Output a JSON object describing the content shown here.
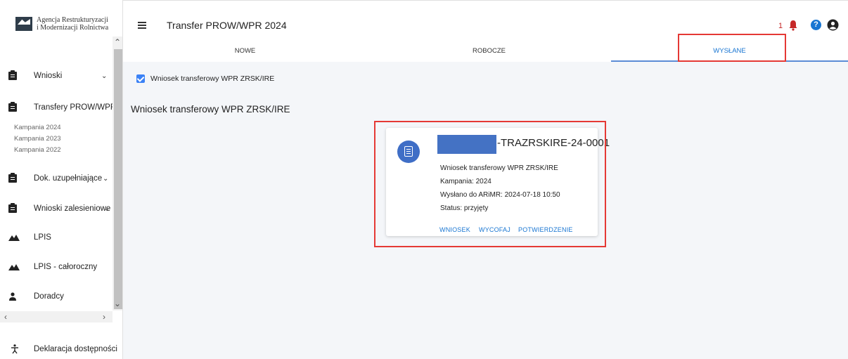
{
  "logo": {
    "line1": "Agencja Restrukturyzacji",
    "line2": "i Modernizacji Rolnictwa"
  },
  "header": {
    "title": "Transfer PROW/WPR 2024",
    "notification_count": "1"
  },
  "tabs": [
    {
      "label": "NOWE",
      "active": false
    },
    {
      "label": "ROBOCZE",
      "active": false
    },
    {
      "label": "WYSŁANE",
      "active": true
    }
  ],
  "sidebar": {
    "items": [
      {
        "label": "Wnioski",
        "icon": "clipboard-icon",
        "chevron": "⌄"
      },
      {
        "label": "Transfery PROW/WPR",
        "icon": "clipboard-icon"
      },
      {
        "label": "Dok. uzupełniające",
        "icon": "clipboard-icon",
        "chevron": "⌄"
      },
      {
        "label": "Wnioski zalesieniowe",
        "icon": "clipboard-icon",
        "chevron": "⌄"
      },
      {
        "label": "LPIS",
        "icon": "terrain-icon"
      },
      {
        "label": "LPIS - całoroczny",
        "icon": "terrain-icon"
      },
      {
        "label": "Doradcy",
        "icon": "person-icon"
      }
    ],
    "campaigns": [
      "Kampania 2024",
      "Kampania 2023",
      "Kampania 2022"
    ],
    "accessibility": "Deklaracja dostępności"
  },
  "content": {
    "filter_checkbox_label": "Wniosek transferowy WPR ZRSK/IRE",
    "filter_checked": true,
    "section_title": "Wniosek transferowy WPR ZRSK/IRE",
    "card": {
      "id_suffix": "-TRAZRSKIRE-24-0001",
      "type": "Wniosek transferowy WPR ZRSK/IRE",
      "campaign": "Kampania: 2024",
      "sent": "Wysłano do ARiMR: 2024-07-18 10:50",
      "status": "Status: przyjęty",
      "actions": [
        "WNIOSEK",
        "WYCOFAJ",
        "POTWIERDZENIE"
      ]
    }
  },
  "colors": {
    "accent": "#1976d2",
    "highlight": "#e53935",
    "redaction": "#4472c4"
  }
}
